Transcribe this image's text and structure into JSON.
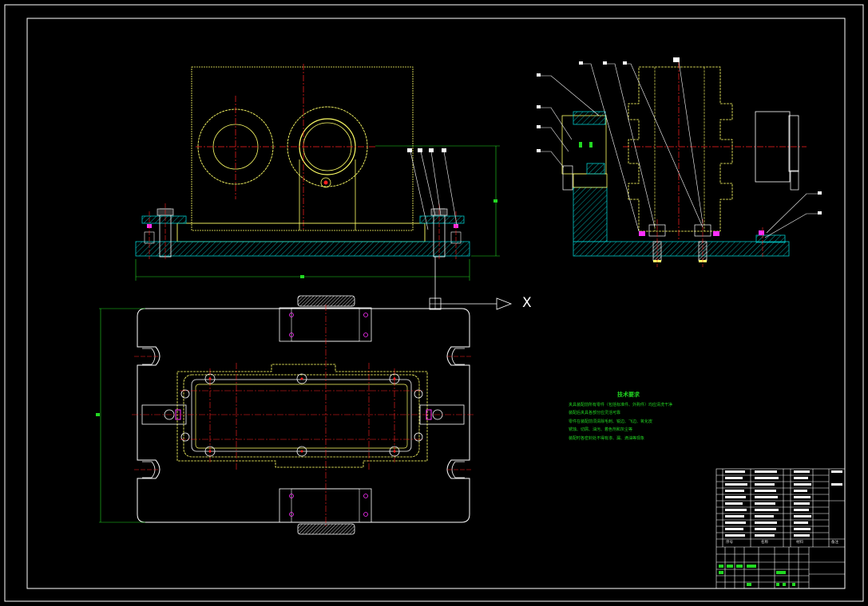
{
  "drawing": {
    "axis_label": "X",
    "tech_notes": {
      "title": "技术要求",
      "lines": [
        "夹具装配前所有零件（包括标准件、外购件）均应清洗干净",
        "装配后夹具各部分应灵活可靠",
        "零件在装配前须清除毛刺、锐边、飞边、氧化皮",
        "锈蚀、切屑、油污、着色剂和灰尘等",
        "装配时各密封处不得有渗、漏、滴油等现象"
      ]
    },
    "title_block": {
      "col_serial": "序号",
      "col_name": "名称",
      "col_material": "材料",
      "col_remark": "备注"
    }
  },
  "colors": {
    "background": "#000000",
    "frame": "#ffffff",
    "outline": "#ffff66",
    "centerline": "#ff2020",
    "hatch": "#00c8c8",
    "dimension": "#22d822",
    "magenta": "#ff30ff"
  }
}
